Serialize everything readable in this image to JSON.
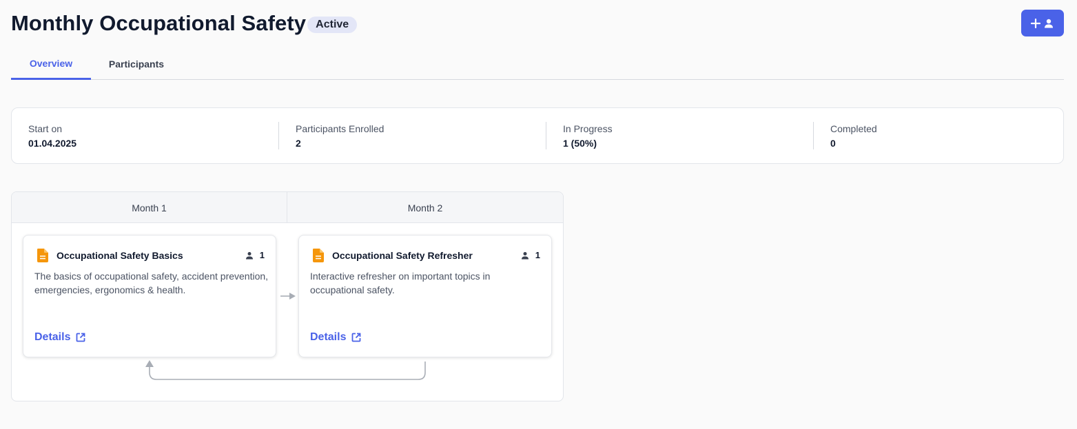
{
  "header": {
    "title": "Monthly Occupational Safety",
    "status": "Active"
  },
  "tabs": [
    {
      "label": "Overview",
      "active": true
    },
    {
      "label": "Participants",
      "active": false
    }
  ],
  "stats": [
    {
      "label": "Start on",
      "value": "01.04.2025"
    },
    {
      "label": "Participants Enrolled",
      "value": "2"
    },
    {
      "label": "In Progress",
      "value": "1 (50%)"
    },
    {
      "label": "Completed",
      "value": "0"
    }
  ],
  "plan": {
    "months": [
      "Month 1",
      "Month 2"
    ],
    "courses": [
      {
        "title": "Occupational Safety Basics",
        "participants": "1",
        "description": "The basics of occupational safety, accident prevention, emergencies, ergonomics & health.",
        "details_label": "Details"
      },
      {
        "title": "Occupational Safety Refresher",
        "participants": "1",
        "description": "Interactive refresher on important topics in occupational safety.",
        "details_label": "Details"
      }
    ]
  },
  "icons": {
    "add_participant": "plus-user-icon",
    "course": "document-icon",
    "participants": "person-icon",
    "details": "external-link-icon"
  },
  "colors": {
    "accent": "#4a62e8",
    "course_icon": "#f5960b",
    "badge_bg": "#e3e6f7",
    "connector": "#a8adb5"
  }
}
